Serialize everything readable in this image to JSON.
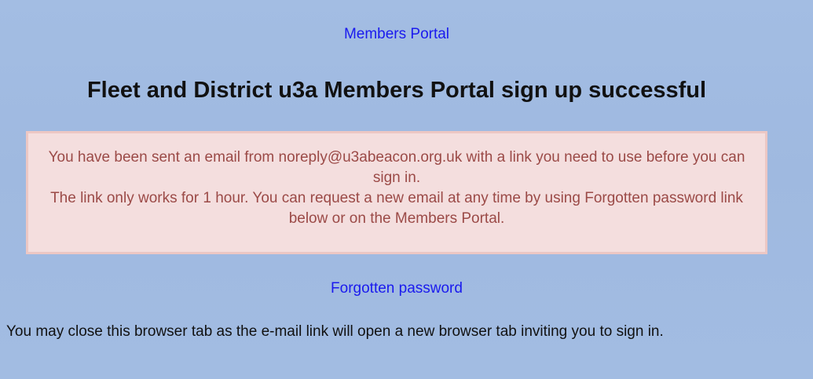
{
  "nav": {
    "portal_link": "Members Portal"
  },
  "header": {
    "title": "Fleet and District u3a Members Portal sign up successful"
  },
  "message": {
    "line1": "You have been sent an email from noreply@u3abeacon.org.uk with a link you need to use before you can sign in.",
    "line2": "The link only works for 1 hour. You can request a new email at any time by using Forgotten password link below or on the Members Portal."
  },
  "links": {
    "forgotten_password": "Forgotten password"
  },
  "footer": {
    "note": "You may close this browser tab as the e-mail link will open a new browser tab inviting you to sign in."
  },
  "colors": {
    "background": "#a2bce2",
    "link": "#1a1aee",
    "alert_text": "#9b4a47",
    "alert_bg": "#f4dede",
    "alert_border": "#ecc7c4"
  }
}
